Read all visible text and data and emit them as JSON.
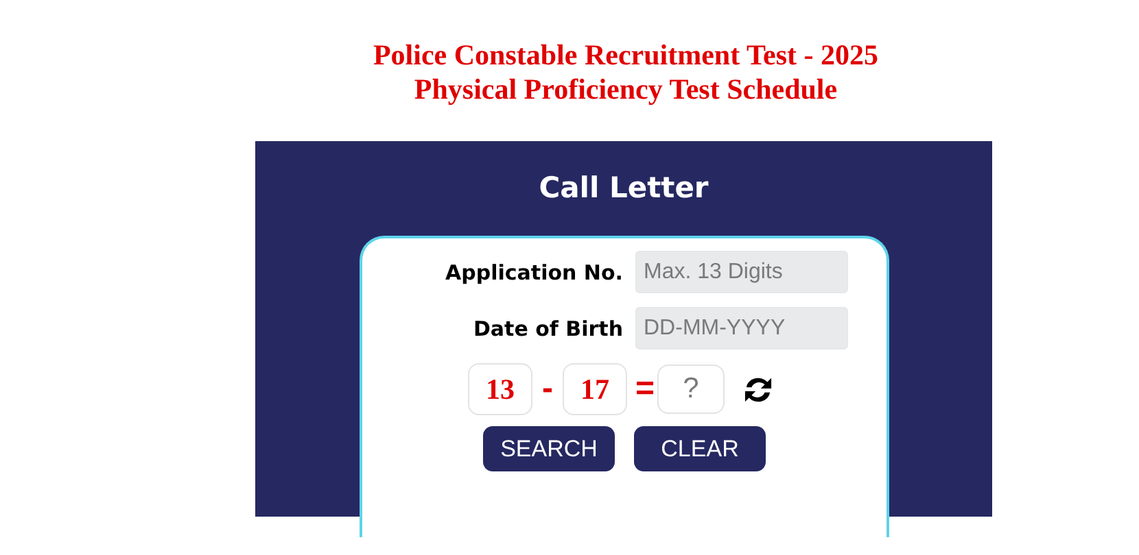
{
  "header": {
    "title": "Police Constable Recruitment Test - 2025",
    "subtitle": "Physical Proficiency Test Schedule"
  },
  "panel": {
    "title": "Call Letter",
    "fields": [
      {
        "label": "Application No.",
        "placeholder": "Max. 13 Digits"
      },
      {
        "label": "Date of Birth",
        "placeholder": "DD-MM-YYYY"
      }
    ],
    "captcha": {
      "first": "13",
      "operator": "-",
      "second": "17",
      "equals": "=",
      "answer_placeholder": "?"
    },
    "buttons": [
      "SEARCH",
      "CLEAR"
    ]
  }
}
